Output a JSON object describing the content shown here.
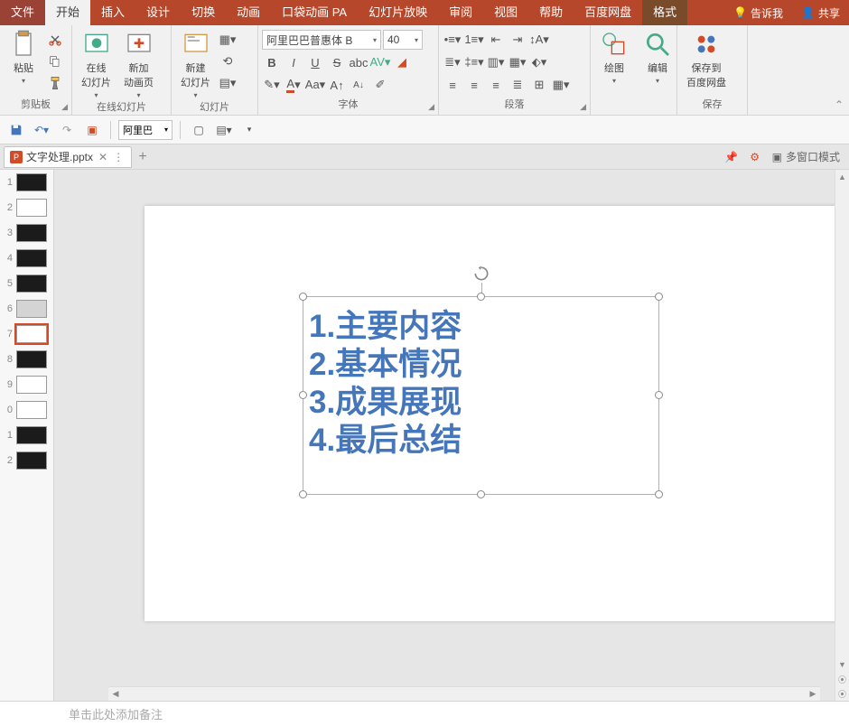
{
  "menu": {
    "file": "文件",
    "home": "开始",
    "insert": "插入",
    "design": "设计",
    "transition": "切换",
    "animation": "动画",
    "pocket": "口袋动画 PA",
    "slideshow": "幻灯片放映",
    "review": "审阅",
    "view": "视图",
    "help": "帮助",
    "baidu": "百度网盘",
    "format": "格式",
    "tellme": "告诉我",
    "share": "共享"
  },
  "ribbon": {
    "clipboard": {
      "paste": "粘贴",
      "label": "剪贴板"
    },
    "online": {
      "btn1": "在线\n幻灯片",
      "btn2": "新加\n动画页",
      "label": "在线幻灯片"
    },
    "slides": {
      "newslide": "新建\n幻灯片",
      "label": "幻灯片"
    },
    "font": {
      "name": "阿里巴巴普惠体 B",
      "size": "40",
      "label": "字体"
    },
    "para": {
      "label": "段落"
    },
    "draw": {
      "btn": "绘图"
    },
    "edit": {
      "btn": "编辑"
    },
    "save": {
      "btn": "保存到\n百度网盘",
      "label": "保存"
    }
  },
  "qat": {
    "fontsel": "阿里巴"
  },
  "doc": {
    "name": "文字处理.pptx"
  },
  "tabright": {
    "multiwin": "多窗口模式"
  },
  "thumbs": [
    {
      "n": "1",
      "cls": "dark"
    },
    {
      "n": "2",
      "cls": ""
    },
    {
      "n": "3",
      "cls": "dark"
    },
    {
      "n": "4",
      "cls": "dark"
    },
    {
      "n": "5",
      "cls": "dark"
    },
    {
      "n": "6",
      "cls": "gray"
    },
    {
      "n": "7",
      "cls": "",
      "sel": true
    },
    {
      "n": "8",
      "cls": "dark"
    },
    {
      "n": "9",
      "cls": ""
    },
    {
      "n": "0",
      "cls": ""
    },
    {
      "n": "1",
      "cls": "dark"
    },
    {
      "n": "2",
      "cls": "dark"
    }
  ],
  "text": {
    "l1": "1.主要内容",
    "l2": "2.基本情况",
    "l3": "3.成果展现",
    "l4": "4.最后总结"
  },
  "notes": "单击此处添加备注"
}
